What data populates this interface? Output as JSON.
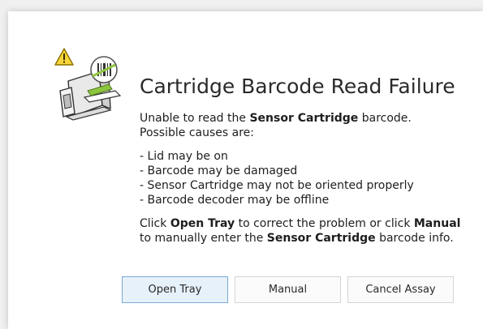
{
  "dialog": {
    "title": "Cartridge Barcode Read Failure",
    "message": {
      "line1_pre": "Unable to read the ",
      "line1_bold": "Sensor Cartridge",
      "line1_post": " barcode.",
      "line2": "Possible causes are:"
    },
    "causes": [
      "- Lid may be on",
      "- Barcode may be damaged",
      "- Sensor Cartridge may not be oriented properly",
      "- Barcode decoder may be offline"
    ],
    "instructions": {
      "part1": "Click ",
      "bold1": "Open Tray",
      "part2": " to correct the problem or click ",
      "bold2": "Manual",
      "part3": " to manually enter the ",
      "bold3": "Sensor Cartridge",
      "part4": " barcode info."
    },
    "buttons": {
      "open_tray": "Open Tray",
      "manual": "Manual",
      "cancel_assay": "Cancel Assay"
    },
    "icons": {
      "warning": "warning-icon",
      "analyzer": "analyzer-device-icon",
      "barcode_scan": "barcode-scan-icon"
    },
    "colors": {
      "warning_yellow": "#f5d53b",
      "scan_green": "#8dc63f",
      "primary_button_bg": "#e7f1fa",
      "primary_button_border": "#79a9d3"
    }
  }
}
